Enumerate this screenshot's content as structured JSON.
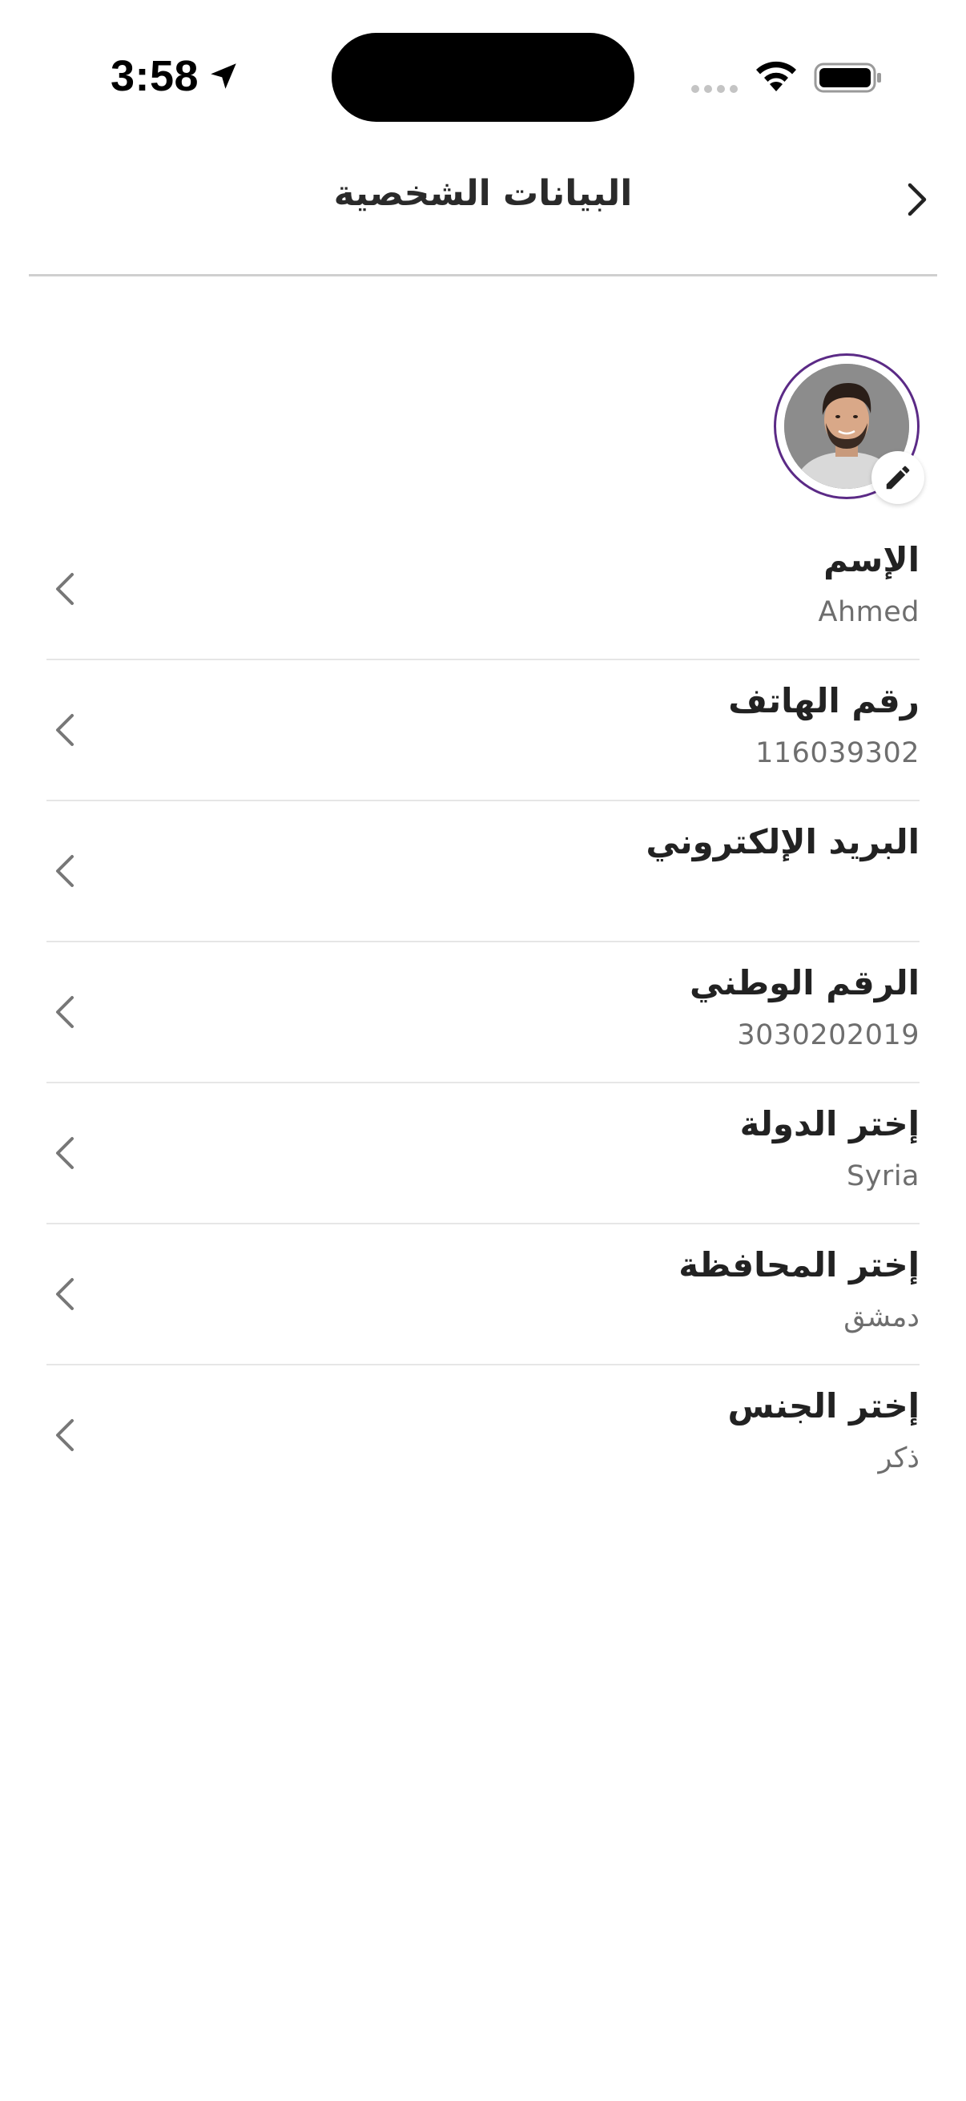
{
  "status_bar": {
    "time": "3:58"
  },
  "header": {
    "title": "البيانات الشخصية"
  },
  "profile": {
    "avatar_alt": "profile photo"
  },
  "fields": [
    {
      "label": "الإسم",
      "value": "Ahmed"
    },
    {
      "label": "رقم الهاتف",
      "value": "116039302"
    },
    {
      "label": "البريد الإلكتروني",
      "value": ""
    },
    {
      "label": "الرقم الوطني",
      "value": "3030202019"
    },
    {
      "label": "إختر الدولة",
      "value": "Syria"
    },
    {
      "label": "إختر المحافظة",
      "value": "دمشق"
    },
    {
      "label": "إختر الجنس",
      "value": "ذكر"
    }
  ],
  "colors": {
    "accent": "#5b2a86",
    "title_text": "#2a2a2a",
    "value_text": "#6e6e6e",
    "divider": "#e6e6e6"
  },
  "icons": {
    "back": "chevron-right-icon",
    "row": "chevron-left-icon",
    "edit": "pencil-icon"
  }
}
